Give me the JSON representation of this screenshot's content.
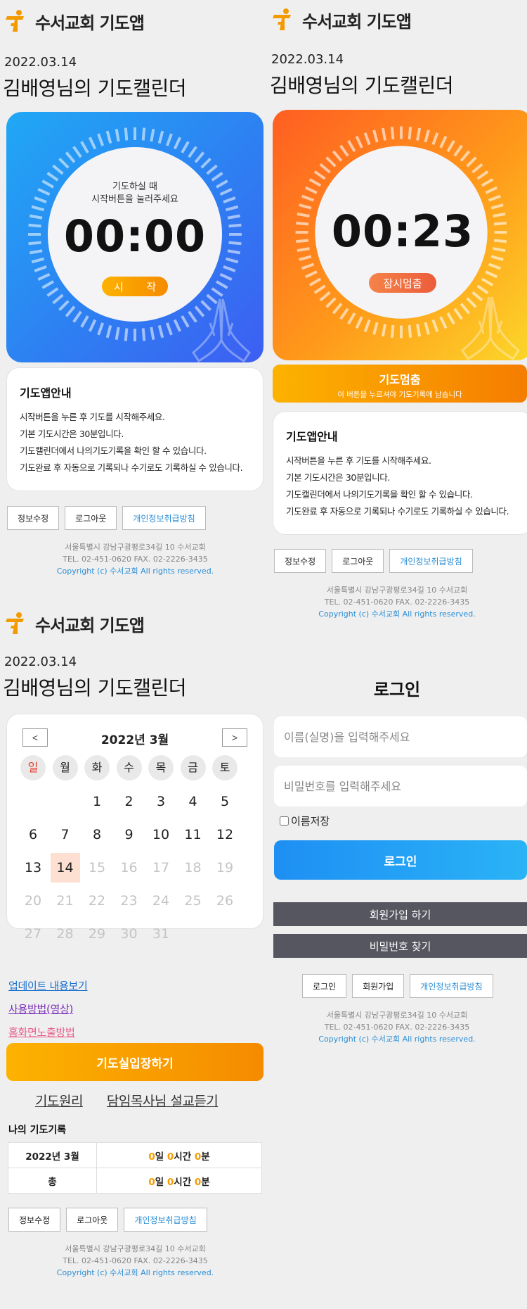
{
  "brand": {
    "name": "수서교회 기도앱"
  },
  "header": {
    "date": "2022.03.14",
    "title": "김배영님의 기도캘린더"
  },
  "timer_idle": {
    "hint_line1": "기도하실 때",
    "hint_line2": "시작버튼을 눌러주세요",
    "clock": "00:00",
    "start_label": "시 작"
  },
  "timer_running": {
    "clock": "00:23",
    "pause_label": "잠시멈춤"
  },
  "stop_bar": {
    "title": "기도멈춤",
    "subtitle": "이 버튼을 누르셔야 기도기록에 남습니다"
  },
  "guide": {
    "heading": "기도앱안내",
    "lines": [
      "시작버튼을 누른 후 기도를 시작해주세요.",
      "기본 기도시간은 30분입니다.",
      "기도캘린더에서 나의기도기록을 확인 할 수 있습니다.",
      "기도완료 후 자동으로 기록되나 수기로도 기록하실 수 있습니다."
    ]
  },
  "account_buttons": {
    "edit": "정보수정",
    "logout": "로그아웃",
    "privacy": "개인정보취급방침"
  },
  "footer": {
    "address": "서울특별시 강남구광평로34길 10 수서교회",
    "tel": "TEL. 02-451-0620   FAX. 02-2226-3435",
    "copyright": "Copyright (c) 수서교회 All rights reserved."
  },
  "calendar": {
    "prev": "<",
    "next": ">",
    "month_label": "2022년 3월",
    "weekdays": [
      "일",
      "월",
      "화",
      "수",
      "목",
      "금",
      "토"
    ],
    "sunday_color": "#e53b2c",
    "today": "14",
    "weeks": [
      [
        "",
        "",
        "1",
        "2",
        "3",
        "4",
        "5"
      ],
      [
        "6",
        "7",
        "8",
        "9",
        "10",
        "11",
        "12"
      ],
      [
        "13",
        "14",
        "15",
        "16",
        "17",
        "18",
        "19"
      ],
      [
        "20",
        "21",
        "22",
        "23",
        "24",
        "25",
        "26"
      ],
      [
        "27",
        "28",
        "29",
        "30",
        "31",
        "",
        ""
      ]
    ]
  },
  "links": {
    "update": "업데이트 내용보기",
    "usage": "사용방법(영상)",
    "homescreen": "홈화면노출방법",
    "colors": {
      "update": "#1a6fd0",
      "usage": "#7a2fb8",
      "homescreen": "#ea5a87"
    }
  },
  "enter_button": "기도실입장하기",
  "sub_links": {
    "principle": "기도원리",
    "sermon": "담임목사님 설교듣기"
  },
  "records": {
    "title": "나의 기도기록",
    "rows": [
      {
        "label": "2022년 3월",
        "days": "0",
        "hours": "0",
        "minutes": "0"
      },
      {
        "label": "총",
        "days": "0",
        "hours": "0",
        "minutes": "0"
      }
    ],
    "unit_day": "일 ",
    "unit_hour": "시간 ",
    "unit_min": "분"
  },
  "login": {
    "title": "로그인",
    "name_placeholder": "이름(실명)을 입력해주세요",
    "password_placeholder": "비밀번호를 입력해주세요",
    "remember_label": "이름저장",
    "login_button": "로그인",
    "signup_button": "회원가입 하기",
    "find_password_button": "비밀번호 찾기",
    "bottom_login": "로그인",
    "bottom_signup": "회원가입",
    "bottom_privacy": "개인정보취급방침"
  }
}
